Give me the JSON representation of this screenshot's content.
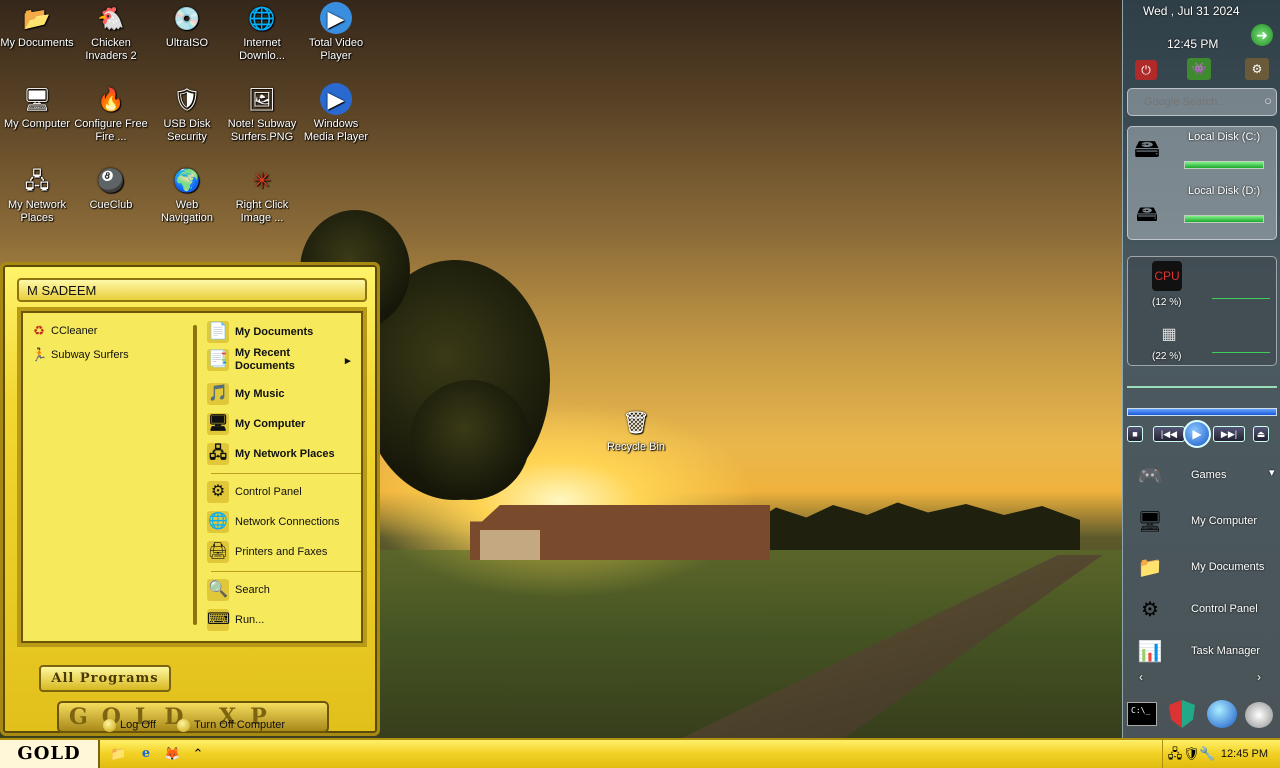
{
  "desktop": {
    "icons": [
      {
        "label": "My Documents",
        "glyph": "📂"
      },
      {
        "label": "Chicken Invaders 2",
        "glyph": "🐔"
      },
      {
        "label": "UltraISO",
        "glyph": "💿"
      },
      {
        "label": "Internet Downlo...",
        "glyph": "🌐"
      },
      {
        "label": "Total Video Player",
        "glyph": "▶"
      },
      {
        "label": "My Computer",
        "glyph": "🖥"
      },
      {
        "label": "Configure Free Fire ...",
        "glyph": "🔥"
      },
      {
        "label": "USB Disk Security",
        "glyph": "🛡"
      },
      {
        "label": "Note! Subway Surfers.PNG",
        "glyph": "🖼"
      },
      {
        "label": "Windows Media Player",
        "glyph": "▶"
      },
      {
        "label": "My Network Places",
        "glyph": "🖧"
      },
      {
        "label": "CueClub",
        "glyph": "🎱"
      },
      {
        "label": "Web Navigation",
        "glyph": "🌍"
      },
      {
        "label": "Right Click Image ...",
        "glyph": "✳"
      },
      {
        "label": "Recycle Bin",
        "glyph": "🗑"
      }
    ]
  },
  "start_menu": {
    "user": "M SADEEM",
    "pinned": [
      {
        "label": "CCleaner",
        "glyph": "♻"
      },
      {
        "label": "Subway Surfers",
        "glyph": "🏃"
      }
    ],
    "places": [
      {
        "label": "My Documents",
        "glyph": "📄"
      },
      {
        "label": "My Recent Documents",
        "glyph": "📑"
      },
      {
        "label": "My Music",
        "glyph": "🎵"
      },
      {
        "label": "My Computer",
        "glyph": "🖥"
      },
      {
        "label": "My Network Places",
        "glyph": "🖧"
      }
    ],
    "submenu_arrow": "▸",
    "system": [
      {
        "label": "Control Panel",
        "glyph": "⚙"
      },
      {
        "label": "Network Connections",
        "glyph": "🌐"
      },
      {
        "label": "Printers and Faxes",
        "glyph": "🖨"
      }
    ],
    "tools": [
      {
        "label": "Search",
        "glyph": "🔍"
      },
      {
        "label": "Run...",
        "glyph": "⌨"
      }
    ],
    "all_programs": "All Programs",
    "footer_brand": "GOLD XP",
    "log_off": "Log Off",
    "turn_off": "Turn Off Computer"
  },
  "taskbar": {
    "start_label": "GOLD XP",
    "quick_launch": [
      {
        "name": "folder-icon",
        "glyph": "📁"
      },
      {
        "name": "internet-explorer-icon",
        "glyph": "e"
      },
      {
        "name": "firefox-icon",
        "glyph": "🦊"
      },
      {
        "name": "expand-icon",
        "glyph": "⌃"
      }
    ],
    "tray_icons": [
      "🖧",
      "🛡",
      "🔧"
    ],
    "clock": "12:45 PM"
  },
  "sidebar": {
    "date": "Wed , Jul 31 2024",
    "time": "12:45 PM",
    "search_placeholder": "Google Search...",
    "drives": [
      {
        "label": "Local Disk (C:)",
        "fill": 0.98
      },
      {
        "label": "Local Disk (D:)",
        "fill": 0.98
      }
    ],
    "cpu_percent": "(12 %)",
    "mem_percent": "(22 %)",
    "links": [
      {
        "label": "Games",
        "glyph": "🎮"
      },
      {
        "label": "My Computer",
        "glyph": "🖥"
      },
      {
        "label": "My Documents",
        "glyph": "📁"
      },
      {
        "label": "Control Panel",
        "glyph": "⚙"
      },
      {
        "label": "Task Manager",
        "glyph": "📊"
      }
    ],
    "dropdown_arrow": "▾",
    "cmd_label": "C:\\_"
  },
  "colors": {
    "start_menu_gold": "#f2d632",
    "taskbar_gold": "#f2d024",
    "sidebar_bg": "#3e4d55",
    "drive_bar": "#1ca82c"
  }
}
